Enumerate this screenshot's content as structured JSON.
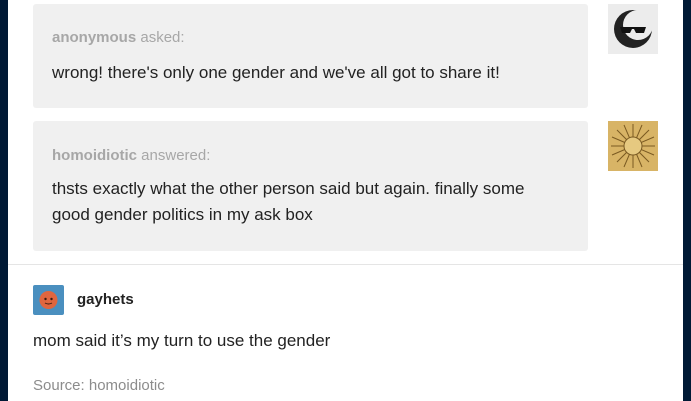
{
  "ask": {
    "asker": "anonymous",
    "verb": "asked:",
    "question": "wrong! there's only one gender and we've all got to share it!"
  },
  "answer": {
    "answerer": "homoidiotic",
    "verb": "answered:",
    "text": "thsts exactly what the other person said but again. finally some good gender politics in my ask box"
  },
  "reblog": {
    "username": "gayhets",
    "text": "mom said it’s my turn to use the gender"
  },
  "source": {
    "label": "Source:",
    "name": "homoidiotic"
  },
  "icons": {
    "asker_avatar": "sunglasses-moon-icon",
    "answerer_avatar": "sun-icon",
    "reblogger_avatar": "face-icon"
  },
  "colors": {
    "bubble": "#f0f0f0",
    "page_bg": "#001935",
    "reblogger_avatar_bg": "#4a8fbf",
    "answerer_avatar_bg": "#d8b466"
  }
}
